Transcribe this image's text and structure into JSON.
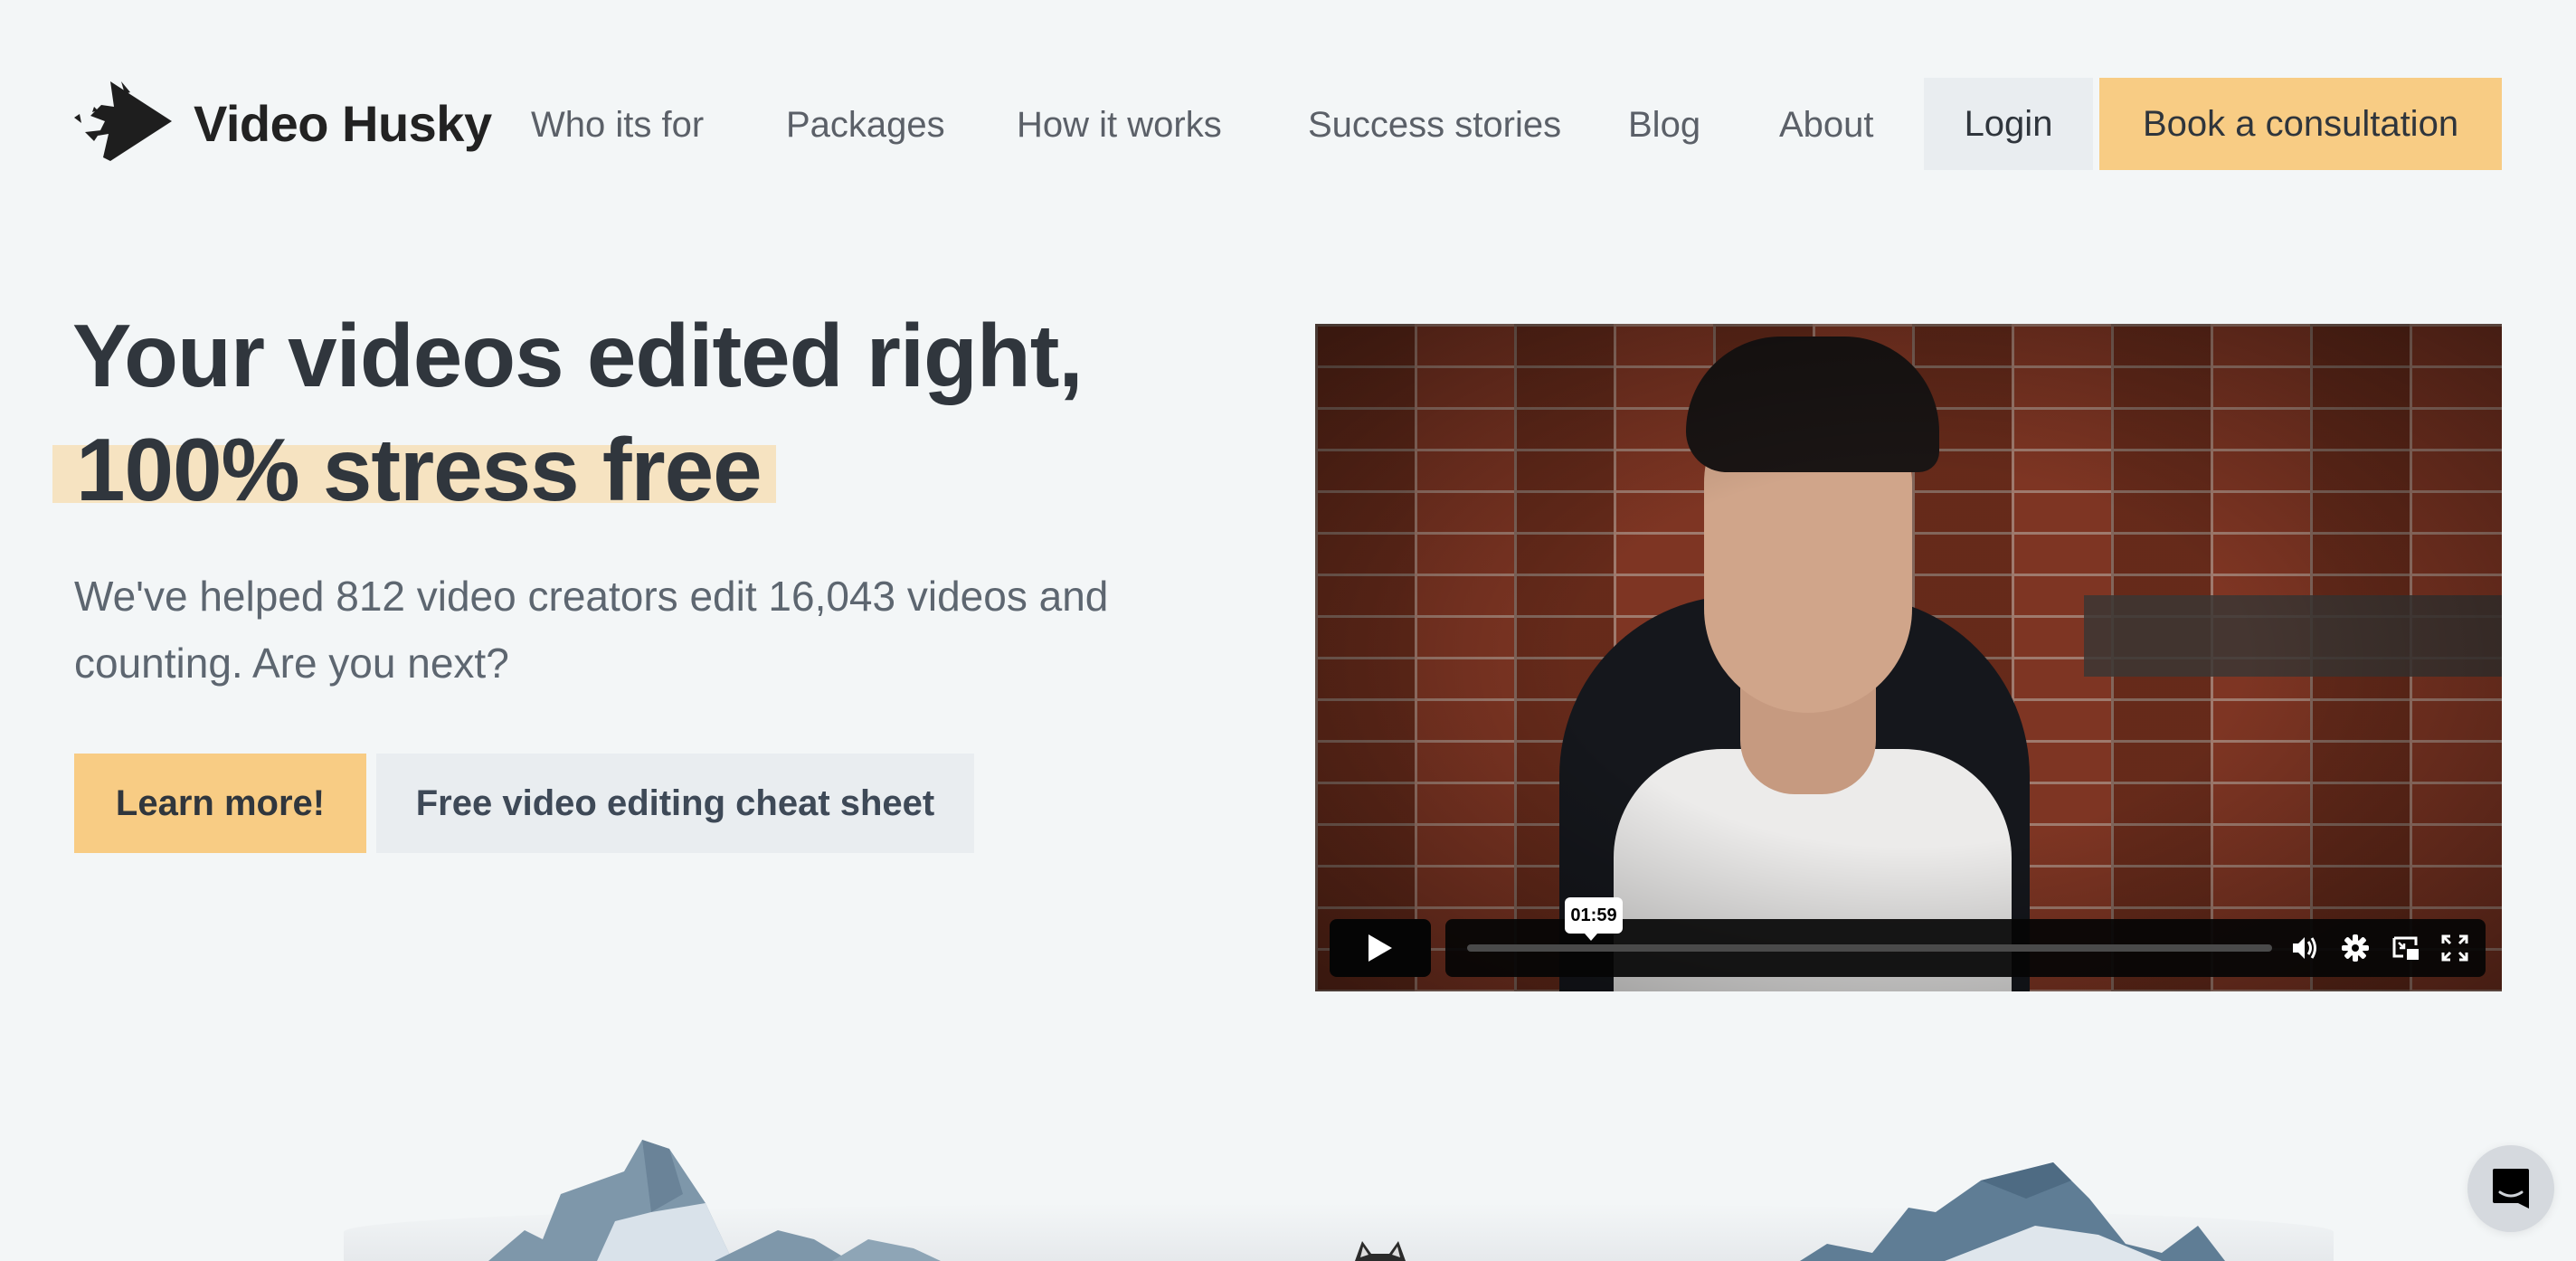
{
  "brand": {
    "name": "Video Husky",
    "logo_icon": "husky-play-logo-icon"
  },
  "nav": {
    "items": [
      {
        "label": "Who its for"
      },
      {
        "label": "Packages"
      },
      {
        "label": "How it works"
      },
      {
        "label": "Success stories"
      },
      {
        "label": "Blog"
      },
      {
        "label": "About"
      }
    ],
    "login_label": "Login",
    "cta_label": "Book a consultation"
  },
  "hero": {
    "headline_line1": "Your videos edited right,",
    "headline_line2": "100% stress free",
    "subtext": "We've helped 812 video creators edit 16,043 videos and counting. Are you next?",
    "primary_button": "Learn more!",
    "secondary_button": "Free video editing cheat sheet"
  },
  "video": {
    "duration_tooltip": "01:59",
    "progress": 0,
    "controls": {
      "play": "play-icon",
      "volume": "volume-icon",
      "settings": "gear-icon",
      "pip": "picture-in-picture-icon",
      "fullscreen": "fullscreen-icon"
    }
  },
  "colors": {
    "background": "#f3f6f7",
    "accent": "#f8cc84",
    "highlight": "#f6e3c1",
    "secondary_button": "#e9edf0",
    "text_dark": "#30363d",
    "text_muted": "#5d6670"
  },
  "chat": {
    "icon": "chat-smile-icon"
  }
}
